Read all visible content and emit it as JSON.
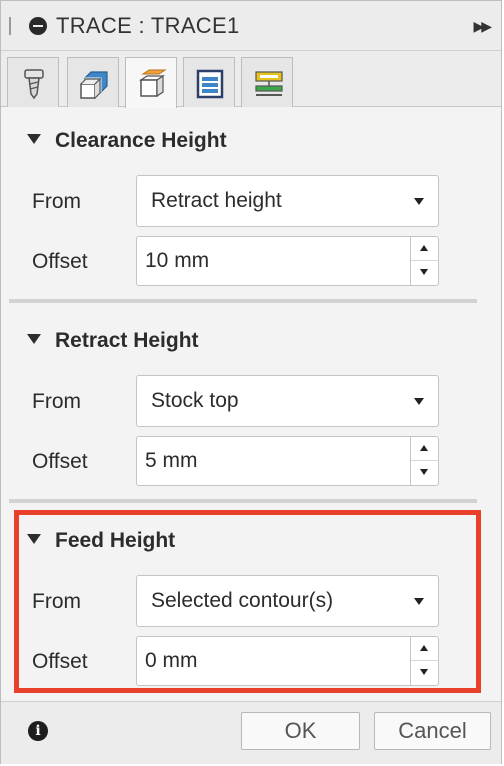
{
  "title": "TRACE : TRACE1",
  "tabs": [
    {
      "icon": "tool-icon",
      "active": false
    },
    {
      "icon": "geometry-icon",
      "active": false
    },
    {
      "icon": "heights-icon",
      "active": true
    },
    {
      "icon": "passes-icon",
      "active": false
    },
    {
      "icon": "linking-icon",
      "active": false
    }
  ],
  "sections": {
    "clearance": {
      "heading": "Clearance Height",
      "from_label": "From",
      "from_value": "Retract height",
      "offset_label": "Offset",
      "offset_value": "10 mm"
    },
    "retract": {
      "heading": "Retract Height",
      "from_label": "From",
      "from_value": "Stock top",
      "offset_label": "Offset",
      "offset_value": "5 mm"
    },
    "feed": {
      "heading": "Feed Height",
      "from_label": "From",
      "from_value": "Selected contour(s)",
      "offset_label": "Offset",
      "offset_value": "0 mm"
    }
  },
  "footer": {
    "info_icon": "i",
    "ok_label": "OK",
    "cancel_label": "Cancel"
  },
  "colors": {
    "highlight": "#e8402a",
    "accent_blue": "#3f86c9",
    "accent_orange": "#f2a13a",
    "accent_yellow": "#e6c31c",
    "accent_green": "#3aa84a"
  }
}
